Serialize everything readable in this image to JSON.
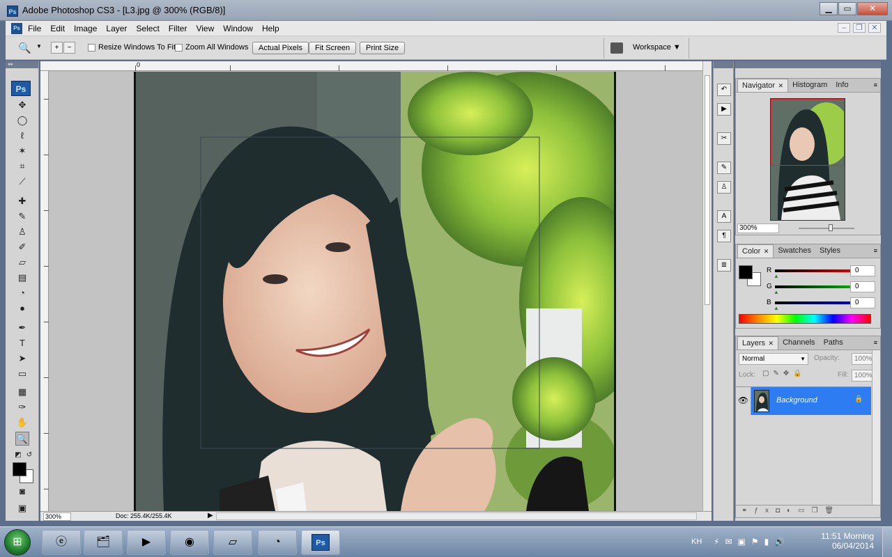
{
  "window": {
    "title": "Adobe Photoshop CS3 - [L3.jpg @ 300% (RGB/8)]",
    "controls": {
      "minimize": "▁",
      "maximize": "▭",
      "close": "✕"
    }
  },
  "menubar": {
    "items": [
      "File",
      "Edit",
      "Image",
      "Layer",
      "Select",
      "Filter",
      "View",
      "Window",
      "Help"
    ],
    "doc_controls": [
      "–",
      "❐",
      "✕"
    ]
  },
  "options_bar": {
    "tool_icon": "zoom-icon",
    "resize_windows": {
      "label": "Resize Windows To Fit",
      "checked": false
    },
    "zoom_all": {
      "label": "Zoom All Windows",
      "checked": false
    },
    "buttons": [
      "Actual Pixels",
      "Fit Screen",
      "Print Size"
    ],
    "workspace": "Workspace ▼"
  },
  "document": {
    "ruler_zero": "0",
    "status": {
      "zoom": "300%",
      "doc_size": "Doc: 255.4K/255.4K"
    }
  },
  "navigator": {
    "tabs": [
      {
        "label": "Navigator",
        "active": true
      },
      {
        "label": "Histogram",
        "active": false
      },
      {
        "label": "Info",
        "active": false
      }
    ],
    "zoom": "300%"
  },
  "color_panel": {
    "tabs": [
      {
        "label": "Color",
        "active": true
      },
      {
        "label": "Swatches",
        "active": false
      },
      {
        "label": "Styles",
        "active": false
      }
    ],
    "sliders": [
      {
        "label": "R",
        "value": "0",
        "color": "#e00000"
      },
      {
        "label": "G",
        "value": "0",
        "color": "#00b000"
      },
      {
        "label": "B",
        "value": "0",
        "color": "#0000e0"
      }
    ]
  },
  "layers_panel": {
    "tabs": [
      {
        "label": "Layers",
        "active": true
      },
      {
        "label": "Channels",
        "active": false
      },
      {
        "label": "Paths",
        "active": false
      }
    ],
    "blend_mode": "Normal",
    "opacity_label": "Opacity:",
    "opacity": "100%",
    "lock_label": "Lock:",
    "fill_label": "Fill:",
    "fill": "100%",
    "layers": [
      {
        "name": "Background",
        "locked": true,
        "visible": true
      }
    ]
  },
  "taskbar": {
    "apps": [
      "internet-explorer",
      "file-explorer",
      "media-player",
      "firefox",
      "app-window",
      "presentation",
      "photoshop"
    ],
    "language": "KH",
    "clock_time": "11:51 Morning",
    "clock_date": "06/04/2014"
  }
}
